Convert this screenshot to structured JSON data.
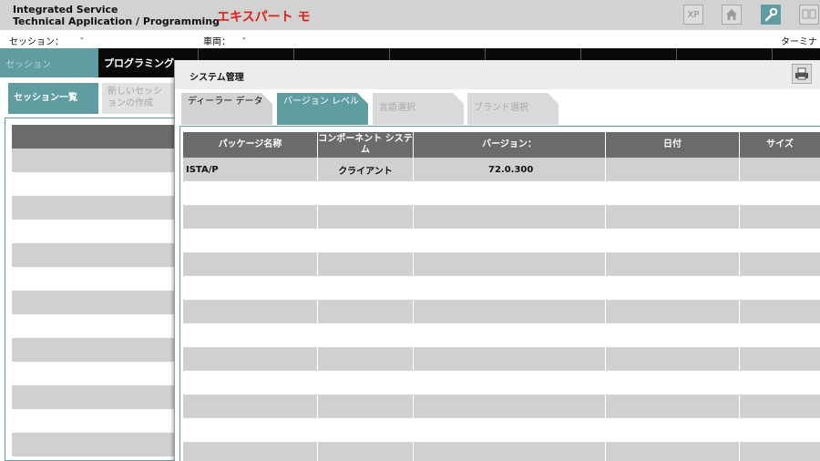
{
  "app": {
    "title_line1": "Integrated Service",
    "title_line2": "Technical Application / Programming",
    "mode": "エキスパート モ"
  },
  "toolbar": {
    "xp_label": "XP",
    "icons": [
      "home-icon",
      "wrench-icon",
      "window-icon"
    ]
  },
  "infobar": {
    "session_label": "セッション：",
    "session_value": "-",
    "vehicle_label": "車両：",
    "vehicle_value": "-",
    "terminal_label": "ターミナ"
  },
  "nav": {
    "session": "セッション",
    "programming": "プログラミング"
  },
  "subtabs": {
    "session_list": "セッション一覧",
    "new_session": "新しいセッションの作成"
  },
  "dialog": {
    "title": "システム管理",
    "tabs": [
      {
        "label": "ディーラー データ"
      },
      {
        "label": "バージョン レベル"
      },
      {
        "label": "言語選択"
      },
      {
        "label": "ブランド選択"
      }
    ],
    "table": {
      "headers": [
        "パッケージ名称",
        "コンポーネント システム",
        "バージョン：",
        "日付",
        "サイズ"
      ],
      "rows": [
        [
          "ISTA/P",
          "クライアント",
          "72.0.300",
          "",
          ""
        ]
      ]
    }
  },
  "colors": {
    "accent": "#5f9da1",
    "mode_red": "#e0201a",
    "header_gray": "#6b6b6b",
    "row_gray": "#d0d0d0"
  }
}
